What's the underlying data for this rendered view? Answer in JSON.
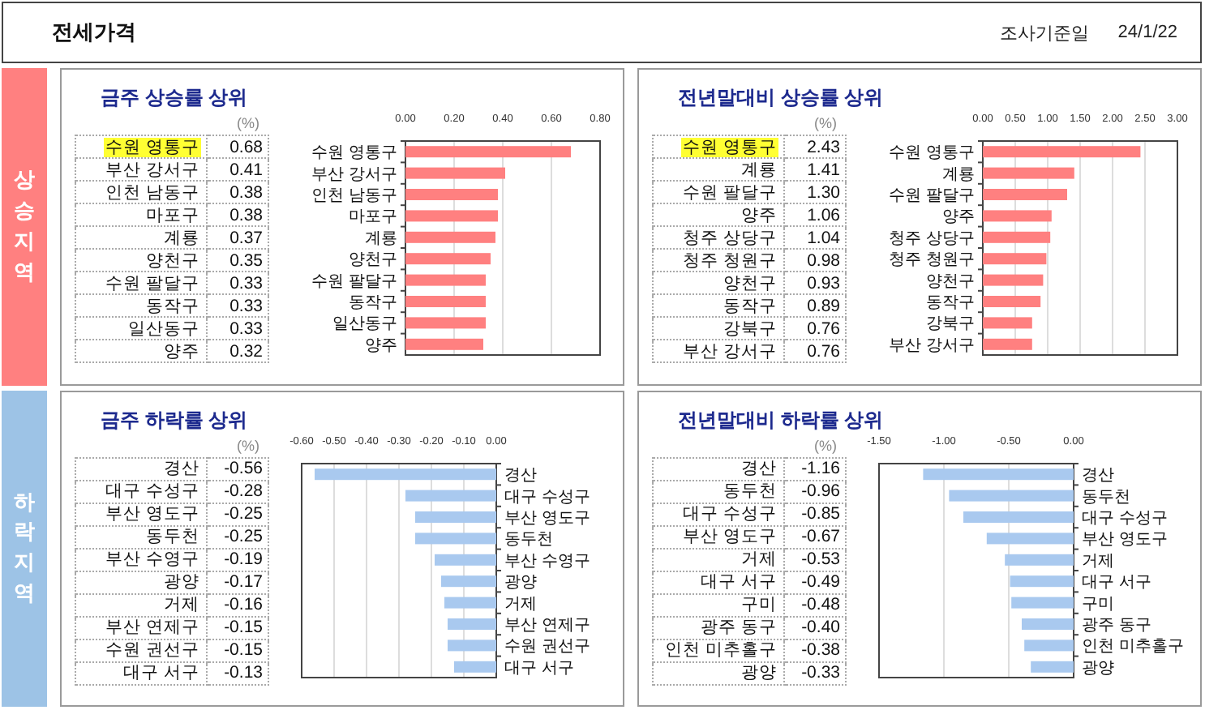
{
  "header": {
    "title": "전세가격",
    "date_label": "조사기준일",
    "date": "24/1/22"
  },
  "sections": [
    {
      "label": "상승지역",
      "color": "#ff8080",
      "panels": [
        {
          "title": "금주 상승률 상위",
          "unit": "(%)",
          "rows": [
            {
              "name": "수원 영통구",
              "value": "0.68",
              "highlighted": true
            },
            {
              "name": "부산 강서구",
              "value": "0.41",
              "highlighted": false
            },
            {
              "name": "인천 남동구",
              "value": "0.38",
              "highlighted": false
            },
            {
              "name": "마포구",
              "value": "0.38",
              "highlighted": false
            },
            {
              "name": "계룡",
              "value": "0.37",
              "highlighted": false
            },
            {
              "name": "양천구",
              "value": "0.35",
              "highlighted": false
            },
            {
              "name": "수원 팔달구",
              "value": "0.33",
              "highlighted": false
            },
            {
              "name": "동작구",
              "value": "0.33",
              "highlighted": false
            },
            {
              "name": "일산동구",
              "value": "0.33",
              "highlighted": false
            },
            {
              "name": "양주",
              "value": "0.32",
              "highlighted": false
            }
          ],
          "chart_data": {
            "type": "bar",
            "orientation": "horizontal",
            "categories": [
              "수원 영통구",
              "부산 강서구",
              "인천 남동구",
              "마포구",
              "계룡",
              "양천구",
              "수원 팔달구",
              "동작구",
              "일산동구",
              "양주"
            ],
            "series": [
              {
                "color": "#ff8080",
                "values": [
                  0.68,
                  0.41,
                  0.38,
                  0.38,
                  0.37,
                  0.35,
                  0.33,
                  0.33,
                  0.33,
                  0.32
                ]
              }
            ],
            "grid": true,
            "xlim": [
              0,
              0.8
            ],
            "xticks": [
              {
                "value": 0,
                "label": "0.00"
              },
              {
                "value": 0.2,
                "label": "0.20"
              },
              {
                "value": 0.4,
                "label": "0.40"
              },
              {
                "value": 0.6,
                "label": "0.60"
              },
              {
                "value": 0.8,
                "label": "0.80"
              }
            ]
          }
        },
        {
          "title": "전년말대비 상승률 상위",
          "unit": "(%)",
          "rows": [
            {
              "name": "수원 영통구",
              "value": "2.43",
              "highlighted": true
            },
            {
              "name": "계룡",
              "value": "1.41",
              "highlighted": false
            },
            {
              "name": "수원 팔달구",
              "value": "1.30",
              "highlighted": false
            },
            {
              "name": "양주",
              "value": "1.06",
              "highlighted": false
            },
            {
              "name": "청주 상당구",
              "value": "1.04",
              "highlighted": false
            },
            {
              "name": "청주 청원구",
              "value": "0.98",
              "highlighted": false
            },
            {
              "name": "양천구",
              "value": "0.93",
              "highlighted": false
            },
            {
              "name": "동작구",
              "value": "0.89",
              "highlighted": false
            },
            {
              "name": "강북구",
              "value": "0.76",
              "highlighted": false
            },
            {
              "name": "부산 강서구",
              "value": "0.76",
              "highlighted": false
            }
          ],
          "chart_data": {
            "type": "bar",
            "orientation": "horizontal",
            "categories": [
              "수원 영통구",
              "계룡",
              "수원 팔달구",
              "양주",
              "청주 상당구",
              "청주 청원구",
              "양천구",
              "동작구",
              "강북구",
              "부산 강서구"
            ],
            "series": [
              {
                "color": "#ff8080",
                "values": [
                  2.43,
                  1.41,
                  1.3,
                  1.06,
                  1.04,
                  0.98,
                  0.93,
                  0.89,
                  0.76,
                  0.76
                ]
              }
            ],
            "grid": true,
            "xlim": [
              0,
              3
            ],
            "xticks": [
              {
                "value": 0,
                "label": "0.00"
              },
              {
                "value": 0.5,
                "label": "0.50"
              },
              {
                "value": 1,
                "label": "1.00"
              },
              {
                "value": 1.5,
                "label": "1.50"
              },
              {
                "value": 2,
                "label": "2.00"
              },
              {
                "value": 2.5,
                "label": "2.50"
              },
              {
                "value": 3,
                "label": "3.00"
              }
            ]
          }
        }
      ]
    },
    {
      "label": "하락지역",
      "color": "#9dc3e6",
      "panels": [
        {
          "title": "금주 하락률 상위",
          "unit": "(%)",
          "rows": [
            {
              "name": "경산",
              "value": "-0.56",
              "highlighted": false
            },
            {
              "name": "대구 수성구",
              "value": "-0.28",
              "highlighted": false
            },
            {
              "name": "부산 영도구",
              "value": "-0.25",
              "highlighted": false
            },
            {
              "name": "동두천",
              "value": "-0.25",
              "highlighted": false
            },
            {
              "name": "부산 수영구",
              "value": "-0.19",
              "highlighted": false
            },
            {
              "name": "광양",
              "value": "-0.17",
              "highlighted": false
            },
            {
              "name": "거제",
              "value": "-0.16",
              "highlighted": false
            },
            {
              "name": "부산 연제구",
              "value": "-0.15",
              "highlighted": false
            },
            {
              "name": "수원 권선구",
              "value": "-0.15",
              "highlighted": false
            },
            {
              "name": "대구 서구",
              "value": "-0.13",
              "highlighted": false
            }
          ],
          "chart_data": {
            "type": "bar",
            "orientation": "horizontal",
            "categories": [
              "경산",
              "대구 수성구",
              "부산 영도구",
              "동두천",
              "부산 수영구",
              "광양",
              "거제",
              "부산 연제구",
              "수원 권선구",
              "대구 서구"
            ],
            "series": [
              {
                "color": "#a9c9ef",
                "values": [
                  -0.56,
                  -0.28,
                  -0.25,
                  -0.25,
                  -0.19,
                  -0.17,
                  -0.16,
                  -0.15,
                  -0.15,
                  -0.13
                ]
              }
            ],
            "grid": true,
            "xlim": [
              -0.6,
              0
            ],
            "xticks": [
              {
                "value": -0.6,
                "label": "-0.60"
              },
              {
                "value": -0.5,
                "label": "-0.50"
              },
              {
                "value": -0.4,
                "label": "-0.40"
              },
              {
                "value": -0.3,
                "label": "-0.30"
              },
              {
                "value": -0.2,
                "label": "-0.20"
              },
              {
                "value": -0.1,
                "label": "-0.10"
              },
              {
                "value": 0,
                "label": "0.00"
              }
            ]
          }
        },
        {
          "title": "전년말대비 하락률 상위",
          "unit": "(%)",
          "rows": [
            {
              "name": "경산",
              "value": "-1.16",
              "highlighted": false
            },
            {
              "name": "동두천",
              "value": "-0.96",
              "highlighted": false
            },
            {
              "name": "대구 수성구",
              "value": "-0.85",
              "highlighted": false
            },
            {
              "name": "부산 영도구",
              "value": "-0.67",
              "highlighted": false
            },
            {
              "name": "거제",
              "value": "-0.53",
              "highlighted": false
            },
            {
              "name": "대구 서구",
              "value": "-0.49",
              "highlighted": false
            },
            {
              "name": "구미",
              "value": "-0.48",
              "highlighted": false
            },
            {
              "name": "광주 동구",
              "value": "-0.40",
              "highlighted": false
            },
            {
              "name": "인천 미추홀구",
              "value": "-0.38",
              "highlighted": false
            },
            {
              "name": "광양",
              "value": "-0.33",
              "highlighted": false
            }
          ],
          "chart_data": {
            "type": "bar",
            "orientation": "horizontal",
            "categories": [
              "경산",
              "동두천",
              "대구 수성구",
              "부산 영도구",
              "거제",
              "대구 서구",
              "구미",
              "광주 동구",
              "인천 미추홀구",
              "광양"
            ],
            "series": [
              {
                "color": "#a9c9ef",
                "values": [
                  -1.16,
                  -0.96,
                  -0.85,
                  -0.67,
                  -0.53,
                  -0.49,
                  -0.48,
                  -0.4,
                  -0.38,
                  -0.33
                ]
              }
            ],
            "grid": true,
            "xlim": [
              -1.5,
              0
            ],
            "xticks": [
              {
                "value": -1.5,
                "label": "-1.50"
              },
              {
                "value": -1,
                "label": "-1.00"
              },
              {
                "value": -0.5,
                "label": "-0.50"
              },
              {
                "value": 0,
                "label": "0.00"
              }
            ]
          }
        }
      ]
    }
  ]
}
